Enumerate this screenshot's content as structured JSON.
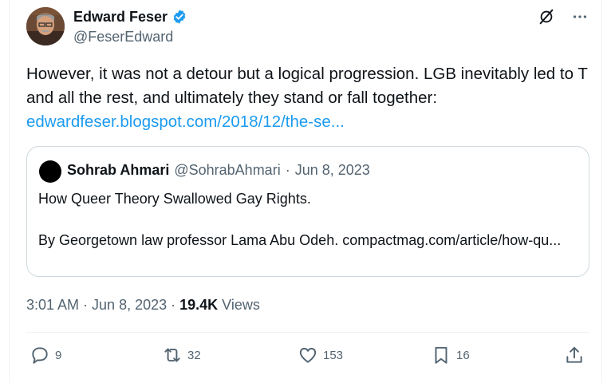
{
  "tweet": {
    "author_name": "Edward Feser",
    "author_handle": "@FeserEdward",
    "text": "However, it was not a detour but a logical progression. LGB inevitably led to T and all the rest, and ultimately they stand or fall together:",
    "link": "edwardfeser.blogspot.com/2018/12/the-se...",
    "time": "3:01 AM",
    "date": "Jun 8, 2023",
    "views_count": "19.4K",
    "views_label": "Views"
  },
  "quote": {
    "author_name": "Sohrab Ahmari",
    "author_handle": "@SohrabAhmari",
    "date": "Jun 8, 2023",
    "line1": "How Queer Theory Swallowed Gay Rights.",
    "line2": "By Georgetown law professor Lama Abu Odeh. compactmag.com/article/how-qu..."
  },
  "actions": {
    "replies": "9",
    "reposts": "32",
    "likes": "153",
    "bookmarks": "16"
  },
  "separator": "·",
  "colors": {
    "accent": "#1d9bf0",
    "muted": "#536471",
    "text": "#0f1419",
    "border": "#cfd9de"
  },
  "icons": [
    "verified-badge-icon",
    "grok-icon",
    "more-icon",
    "reply-icon",
    "repost-icon",
    "like-icon",
    "bookmark-icon",
    "share-icon"
  ]
}
